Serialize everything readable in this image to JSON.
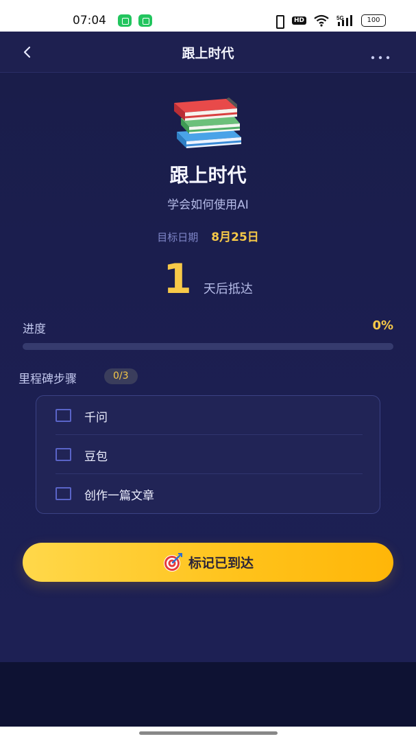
{
  "status_bar": {
    "time": "07:04",
    "hd": "HD",
    "network": "5G",
    "battery": "100"
  },
  "header": {
    "title": "跟上时代"
  },
  "goal": {
    "icon": "books-icon",
    "title": "跟上时代",
    "subtitle": "学会如何使用AI",
    "target_label": "目标日期",
    "target_date": "8月25日",
    "days_left": "1",
    "days_unit": "天后抵达"
  },
  "progress": {
    "label": "进度",
    "value_text": "0%",
    "percent": 0
  },
  "milestones": {
    "label": "里程碑步骤",
    "count": "0/3",
    "steps": [
      {
        "text": "千问",
        "checked": false
      },
      {
        "text": "豆包",
        "checked": false
      },
      {
        "text": "创作一篇文章",
        "checked": false
      }
    ]
  },
  "action": {
    "label": "标记已到达",
    "icon": "target-icon"
  },
  "colors": {
    "accent": "#f7c948",
    "background": "#1c1f52",
    "card": "#212456"
  }
}
